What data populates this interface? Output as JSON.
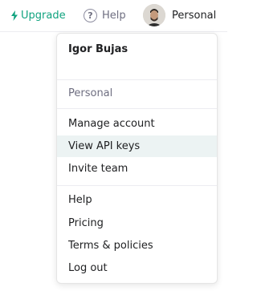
{
  "topbar": {
    "upgrade_label": "Upgrade",
    "help_label": "Help",
    "account_label": "Personal"
  },
  "menu": {
    "user_name": "Igor Bujas",
    "org_name": "Personal",
    "account_items": [
      {
        "label": "Manage account"
      },
      {
        "label": "View API keys"
      },
      {
        "label": "Invite team"
      }
    ],
    "resource_items": [
      {
        "label": "Help"
      },
      {
        "label": "Pricing"
      },
      {
        "label": "Terms & policies"
      },
      {
        "label": "Log out"
      }
    ],
    "highlighted_item": "View API keys"
  },
  "colors": {
    "accent": "#10a37f",
    "highlight": "#ecf3f3"
  },
  "icons": {
    "upgrade": "lightning-bolt-icon",
    "help": "question-circle-icon"
  }
}
